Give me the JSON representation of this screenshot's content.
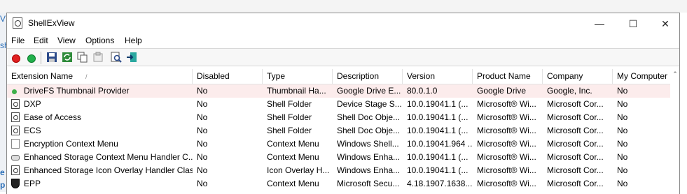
{
  "window": {
    "title": "ShellExView"
  },
  "background": {
    "left_chars": [
      "V",
      "sh",
      "e",
      "p"
    ]
  },
  "menu": [
    "File",
    "Edit",
    "View",
    "Options",
    "Help"
  ],
  "toolbar": {
    "buttons": [
      "disable-red-icon",
      "enable-green-icon",
      "save-icon",
      "refresh-icon",
      "copy-icon",
      "properties-icon",
      "find-icon",
      "exit-icon"
    ],
    "colors": {
      "red": "#e02020",
      "green": "#22b14c"
    }
  },
  "columns": [
    "Extension Name",
    "Disabled",
    "Type",
    "Description",
    "Version",
    "Product Name",
    "Company",
    "My Computer"
  ],
  "sort_arrow": "/",
  "rows": [
    {
      "icon": "green-dot-icon",
      "name": "DriveFS Thumbnail Provider",
      "disabled": "No",
      "type": "Thumbnail Ha...",
      "description": "Google Drive E...",
      "version": "80.0.1.0",
      "product": "Google Drive",
      "company": "Google, Inc.",
      "mycomputer": "No"
    },
    {
      "icon": "document-icon",
      "name": "DXP",
      "disabled": "No",
      "type": "Shell Folder",
      "description": "Device Stage S...",
      "version": "10.0.19041.1 (...",
      "product": "Microsoft® Wi...",
      "company": "Microsoft Cor...",
      "mycomputer": "No"
    },
    {
      "icon": "document-icon",
      "name": "Ease of Access",
      "disabled": "No",
      "type": "Shell Folder",
      "description": "Shell Doc Obje...",
      "version": "10.0.19041.1 (...",
      "product": "Microsoft® Wi...",
      "company": "Microsoft Cor...",
      "mycomputer": "No"
    },
    {
      "icon": "document-icon",
      "name": "ECS",
      "disabled": "No",
      "type": "Shell Folder",
      "description": "Shell Doc Obje...",
      "version": "10.0.19041.1 (...",
      "product": "Microsoft® Wi...",
      "company": "Microsoft Cor...",
      "mycomputer": "No"
    },
    {
      "icon": "blank-document-icon",
      "name": "Encryption Context Menu",
      "disabled": "No",
      "type": "Context Menu",
      "description": "Windows Shell...",
      "version": "10.0.19041.964 ...",
      "product": "Microsoft® Wi...",
      "company": "Microsoft Cor...",
      "mycomputer": "No"
    },
    {
      "icon": "drive-icon",
      "name": "Enhanced Storage Context Menu Handler C...",
      "disabled": "No",
      "type": "Context Menu",
      "description": "Windows Enha...",
      "version": "10.0.19041.1 (...",
      "product": "Microsoft® Wi...",
      "company": "Microsoft Cor...",
      "mycomputer": "No"
    },
    {
      "icon": "document-icon",
      "name": "Enhanced Storage Icon Overlay Handler Class",
      "disabled": "No",
      "type": "Icon Overlay H...",
      "description": "Windows Enha...",
      "version": "10.0.19041.1 (...",
      "product": "Microsoft® Wi...",
      "company": "Microsoft Cor...",
      "mycomputer": "No"
    },
    {
      "icon": "shield-icon",
      "name": "EPP",
      "disabled": "No",
      "type": "Context Menu",
      "description": "Microsoft Secu...",
      "version": "4.18.1907.1638...",
      "product": "Microsoft® Wi...",
      "company": "Microsoft Cor...",
      "mycomputer": "No"
    }
  ]
}
